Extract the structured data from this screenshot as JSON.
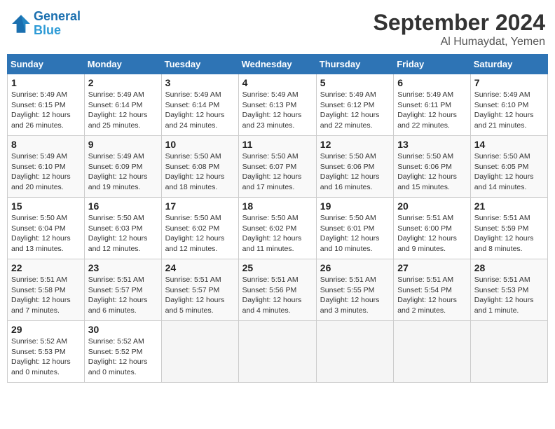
{
  "header": {
    "logo_line1": "General",
    "logo_line2": "Blue",
    "month_title": "September 2024",
    "location": "Al Humaydat, Yemen"
  },
  "weekdays": [
    "Sunday",
    "Monday",
    "Tuesday",
    "Wednesday",
    "Thursday",
    "Friday",
    "Saturday"
  ],
  "weeks": [
    [
      {
        "day": "1",
        "sunrise": "5:49 AM",
        "sunset": "6:15 PM",
        "daylight": "12 hours and 26 minutes."
      },
      {
        "day": "2",
        "sunrise": "5:49 AM",
        "sunset": "6:14 PM",
        "daylight": "12 hours and 25 minutes."
      },
      {
        "day": "3",
        "sunrise": "5:49 AM",
        "sunset": "6:14 PM",
        "daylight": "12 hours and 24 minutes."
      },
      {
        "day": "4",
        "sunrise": "5:49 AM",
        "sunset": "6:13 PM",
        "daylight": "12 hours and 23 minutes."
      },
      {
        "day": "5",
        "sunrise": "5:49 AM",
        "sunset": "6:12 PM",
        "daylight": "12 hours and 22 minutes."
      },
      {
        "day": "6",
        "sunrise": "5:49 AM",
        "sunset": "6:11 PM",
        "daylight": "12 hours and 22 minutes."
      },
      {
        "day": "7",
        "sunrise": "5:49 AM",
        "sunset": "6:10 PM",
        "daylight": "12 hours and 21 minutes."
      }
    ],
    [
      {
        "day": "8",
        "sunrise": "5:49 AM",
        "sunset": "6:10 PM",
        "daylight": "12 hours and 20 minutes."
      },
      {
        "day": "9",
        "sunrise": "5:49 AM",
        "sunset": "6:09 PM",
        "daylight": "12 hours and 19 minutes."
      },
      {
        "day": "10",
        "sunrise": "5:50 AM",
        "sunset": "6:08 PM",
        "daylight": "12 hours and 18 minutes."
      },
      {
        "day": "11",
        "sunrise": "5:50 AM",
        "sunset": "6:07 PM",
        "daylight": "12 hours and 17 minutes."
      },
      {
        "day": "12",
        "sunrise": "5:50 AM",
        "sunset": "6:06 PM",
        "daylight": "12 hours and 16 minutes."
      },
      {
        "day": "13",
        "sunrise": "5:50 AM",
        "sunset": "6:06 PM",
        "daylight": "12 hours and 15 minutes."
      },
      {
        "day": "14",
        "sunrise": "5:50 AM",
        "sunset": "6:05 PM",
        "daylight": "12 hours and 14 minutes."
      }
    ],
    [
      {
        "day": "15",
        "sunrise": "5:50 AM",
        "sunset": "6:04 PM",
        "daylight": "12 hours and 13 minutes."
      },
      {
        "day": "16",
        "sunrise": "5:50 AM",
        "sunset": "6:03 PM",
        "daylight": "12 hours and 12 minutes."
      },
      {
        "day": "17",
        "sunrise": "5:50 AM",
        "sunset": "6:02 PM",
        "daylight": "12 hours and 12 minutes."
      },
      {
        "day": "18",
        "sunrise": "5:50 AM",
        "sunset": "6:02 PM",
        "daylight": "12 hours and 11 minutes."
      },
      {
        "day": "19",
        "sunrise": "5:50 AM",
        "sunset": "6:01 PM",
        "daylight": "12 hours and 10 minutes."
      },
      {
        "day": "20",
        "sunrise": "5:51 AM",
        "sunset": "6:00 PM",
        "daylight": "12 hours and 9 minutes."
      },
      {
        "day": "21",
        "sunrise": "5:51 AM",
        "sunset": "5:59 PM",
        "daylight": "12 hours and 8 minutes."
      }
    ],
    [
      {
        "day": "22",
        "sunrise": "5:51 AM",
        "sunset": "5:58 PM",
        "daylight": "12 hours and 7 minutes."
      },
      {
        "day": "23",
        "sunrise": "5:51 AM",
        "sunset": "5:57 PM",
        "daylight": "12 hours and 6 minutes."
      },
      {
        "day": "24",
        "sunrise": "5:51 AM",
        "sunset": "5:57 PM",
        "daylight": "12 hours and 5 minutes."
      },
      {
        "day": "25",
        "sunrise": "5:51 AM",
        "sunset": "5:56 PM",
        "daylight": "12 hours and 4 minutes."
      },
      {
        "day": "26",
        "sunrise": "5:51 AM",
        "sunset": "5:55 PM",
        "daylight": "12 hours and 3 minutes."
      },
      {
        "day": "27",
        "sunrise": "5:51 AM",
        "sunset": "5:54 PM",
        "daylight": "12 hours and 2 minutes."
      },
      {
        "day": "28",
        "sunrise": "5:51 AM",
        "sunset": "5:53 PM",
        "daylight": "12 hours and 1 minute."
      }
    ],
    [
      {
        "day": "29",
        "sunrise": "5:52 AM",
        "sunset": "5:53 PM",
        "daylight": "12 hours and 0 minutes."
      },
      {
        "day": "30",
        "sunrise": "5:52 AM",
        "sunset": "5:52 PM",
        "daylight": "12 hours and 0 minutes."
      },
      null,
      null,
      null,
      null,
      null
    ]
  ],
  "labels": {
    "sunrise_prefix": "Sunrise: ",
    "sunset_prefix": "Sunset: ",
    "daylight_prefix": "Daylight: "
  }
}
